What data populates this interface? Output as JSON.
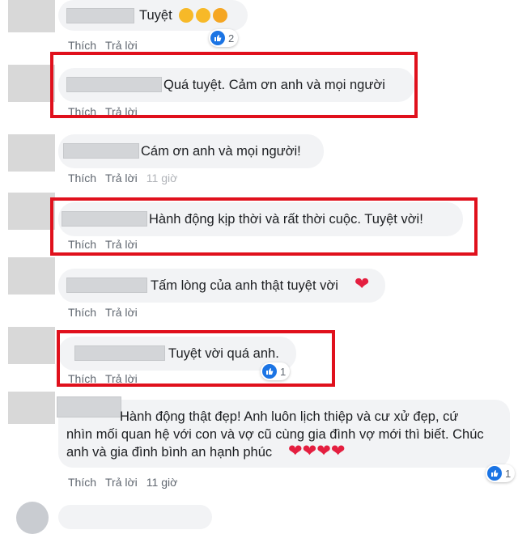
{
  "actions": {
    "like": "Thích",
    "reply": "Trả lời"
  },
  "comments": [
    {
      "text": "Tuyệt",
      "reactions": "2",
      "time": ""
    },
    {
      "text": "Quá tuyệt. Cảm ơn anh và mọi người",
      "reactions": "",
      "time": ""
    },
    {
      "text": "Cám ơn anh và mọi người!",
      "reactions": "",
      "time": "11 giờ"
    },
    {
      "text": "Hành động kịp thời và rất thời cuộc. Tuyệt vời!",
      "reactions": "",
      "time": ""
    },
    {
      "text": "Tấm lòng của anh thật tuyệt vời",
      "reactions": "",
      "time": ""
    },
    {
      "text": "Tuyệt vời quá anh.",
      "reactions": "1",
      "time": ""
    },
    {
      "line1": "Hành động thật đẹp! Anh luôn lịch thiệp và cư xử đẹp, cứ",
      "line2": "nhìn mối quan hệ với con và vợ cũ cùng gia đình vợ mới thì biết. Chúc",
      "line3": "anh và gia đình bình an hạnh phúc",
      "reactions": "1",
      "time": "11 giờ"
    }
  ],
  "colors": {
    "highlight": "#e0101c",
    "like_blue": "#1b74e4",
    "heart_red": "#e41e3f"
  }
}
